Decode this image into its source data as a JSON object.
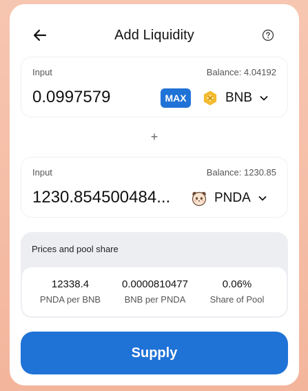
{
  "header": {
    "title": "Add Liquidity",
    "back_icon": "arrow-left-icon",
    "help_icon": "question-circle-icon"
  },
  "input_a": {
    "label": "Input",
    "balance": "Balance: 4.04192",
    "amount": "0.0997579",
    "max_label": "MAX",
    "token": {
      "symbol": "BNB",
      "icon": "bnb-token-icon"
    }
  },
  "input_b": {
    "label": "Input",
    "balance": "Balance: 1230.85",
    "amount": "1230.854500484...",
    "token": {
      "symbol": "PNDA",
      "icon": "panda-token-icon"
    }
  },
  "plus_sign": "+",
  "prices": {
    "title": "Prices and pool share",
    "stats": [
      {
        "value": "12338.4",
        "label": "PNDA per BNB"
      },
      {
        "value": "0.0000810477",
        "label": "BNB per PNDA"
      },
      {
        "value": "0.06%",
        "label": "Share of Pool"
      }
    ]
  },
  "supply_label": "Supply",
  "colors": {
    "accent": "#1f72d6",
    "bnb": "#f3ba2f",
    "background": "#f5bda6"
  }
}
